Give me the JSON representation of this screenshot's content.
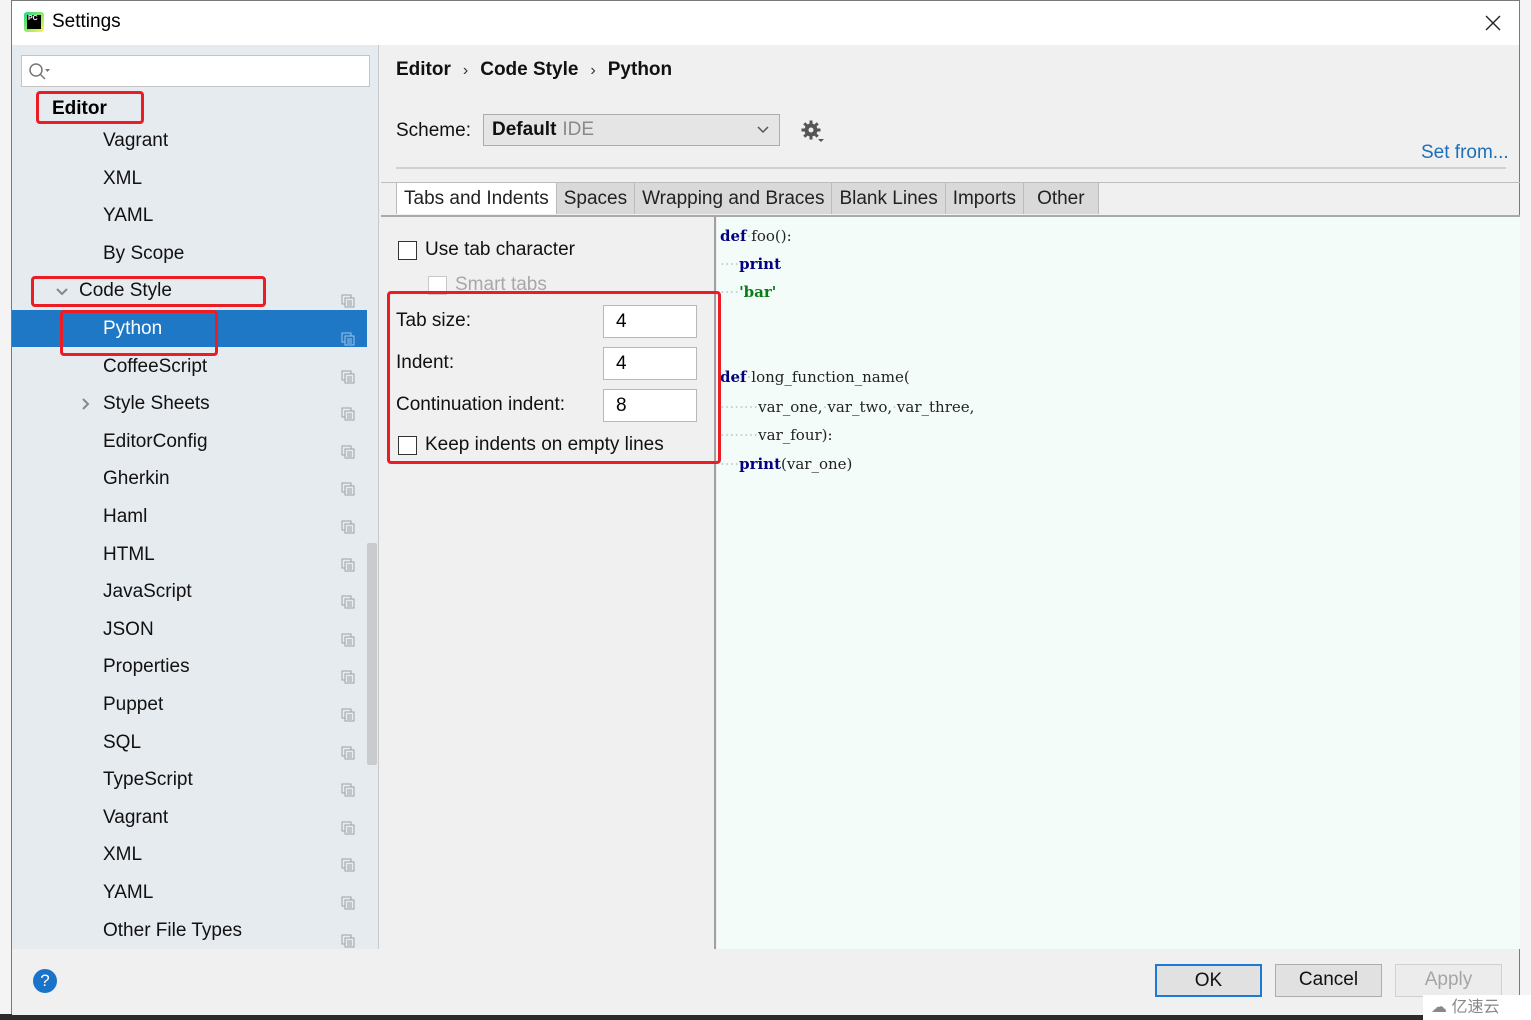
{
  "window": {
    "title": "Settings",
    "app_icon_text": "PC",
    "close_label": "Close"
  },
  "sidebar": {
    "search": {
      "value": "",
      "placeholder": ""
    },
    "heading": "Editor",
    "items": [
      {
        "label": "Vagrant",
        "level": 2,
        "copy_icon": false
      },
      {
        "label": "XML",
        "level": 2,
        "copy_icon": false
      },
      {
        "label": "YAML",
        "level": 2,
        "copy_icon": false
      },
      {
        "label": "By Scope",
        "level": 2,
        "copy_icon": false
      },
      {
        "label": "Code Style",
        "level": 1,
        "expanded": true,
        "copy_icon": true
      },
      {
        "label": "Python",
        "level": 2,
        "selected": true,
        "copy_icon": true
      },
      {
        "label": "CoffeeScript",
        "level": 2,
        "copy_icon": true
      },
      {
        "label": "Style Sheets",
        "level": 2,
        "collapsed": true,
        "copy_icon": true
      },
      {
        "label": "EditorConfig",
        "level": 2,
        "copy_icon": true
      },
      {
        "label": "Gherkin",
        "level": 2,
        "copy_icon": true
      },
      {
        "label": "Haml",
        "level": 2,
        "copy_icon": true
      },
      {
        "label": "HTML",
        "level": 2,
        "copy_icon": true
      },
      {
        "label": "JavaScript",
        "level": 2,
        "copy_icon": true
      },
      {
        "label": "JSON",
        "level": 2,
        "copy_icon": true
      },
      {
        "label": "Properties",
        "level": 2,
        "copy_icon": true
      },
      {
        "label": "Puppet",
        "level": 2,
        "copy_icon": true
      },
      {
        "label": "SQL",
        "level": 2,
        "copy_icon": true
      },
      {
        "label": "TypeScript",
        "level": 2,
        "copy_icon": true
      },
      {
        "label": "Vagrant",
        "level": 2,
        "copy_icon": true
      },
      {
        "label": "XML",
        "level": 2,
        "copy_icon": true
      },
      {
        "label": "YAML",
        "level": 2,
        "copy_icon": true
      },
      {
        "label": "Other File Types",
        "level": 2,
        "copy_icon": true
      }
    ]
  },
  "breadcrumb": [
    "Editor",
    "Code Style",
    "Python"
  ],
  "breadcrumb_sep": "›",
  "scheme": {
    "label": "Scheme:",
    "value": "Default",
    "qualifier": "IDE",
    "set_from": "Set from..."
  },
  "tabs": [
    {
      "label": "Tabs and Indents",
      "active": true
    },
    {
      "label": "Spaces"
    },
    {
      "label": "Wrapping and Braces"
    },
    {
      "label": "Blank Lines"
    },
    {
      "label": "Imports"
    },
    {
      "label": "Other"
    }
  ],
  "options": {
    "use_tab_character": {
      "label": "Use tab character",
      "checked": false
    },
    "smart_tabs": {
      "label": "Smart tabs",
      "checked": false,
      "disabled": true
    },
    "tab_size": {
      "label": "Tab size:",
      "value": "4"
    },
    "indent": {
      "label": "Indent:",
      "value": "4"
    },
    "continuation_indent": {
      "label": "Continuation indent:",
      "value": "8"
    },
    "keep_indents": {
      "label": "Keep indents on empty lines",
      "checked": false
    }
  },
  "preview": {
    "lines": [
      {
        "ws": "",
        "tokens": [
          {
            "t": "def",
            "c": "kw"
          },
          {
            "t": "·",
            "c": "ws"
          },
          {
            "t": "foo():",
            "c": ""
          }
        ]
      },
      {
        "ws": "····",
        "tokens": [
          {
            "t": "print",
            "c": "kw"
          }
        ]
      },
      {
        "ws": "····",
        "tokens": [
          {
            "t": "'bar'",
            "c": "str"
          }
        ]
      },
      {
        "ws": "",
        "tokens": []
      },
      {
        "ws": "",
        "tokens": []
      },
      {
        "ws": "",
        "tokens": [
          {
            "t": "def",
            "c": "kw"
          },
          {
            "t": "·",
            "c": "ws"
          },
          {
            "t": "long_function_name(",
            "c": ""
          }
        ]
      },
      {
        "ws": "········",
        "tokens": [
          {
            "t": "var_one,",
            "c": ""
          },
          {
            "t": "·",
            "c": "ws"
          },
          {
            "t": "var_two,",
            "c": ""
          },
          {
            "t": "·",
            "c": "ws"
          },
          {
            "t": "var_three,",
            "c": ""
          }
        ]
      },
      {
        "ws": "········",
        "tokens": [
          {
            "t": "var_four):",
            "c": ""
          }
        ]
      },
      {
        "ws": "····",
        "tokens": [
          {
            "t": "print",
            "c": "kw"
          },
          {
            "t": "(var_one)",
            "c": ""
          }
        ]
      }
    ]
  },
  "footer": {
    "help": "?",
    "ok": "OK",
    "cancel": "Cancel",
    "apply": "Apply"
  },
  "watermark": "亿速云",
  "colors": {
    "selection": "#1e78c6",
    "highlight_box": "#ec1c24",
    "link": "#1d6fb8",
    "keyword": "#000080",
    "string": "#067d17"
  }
}
